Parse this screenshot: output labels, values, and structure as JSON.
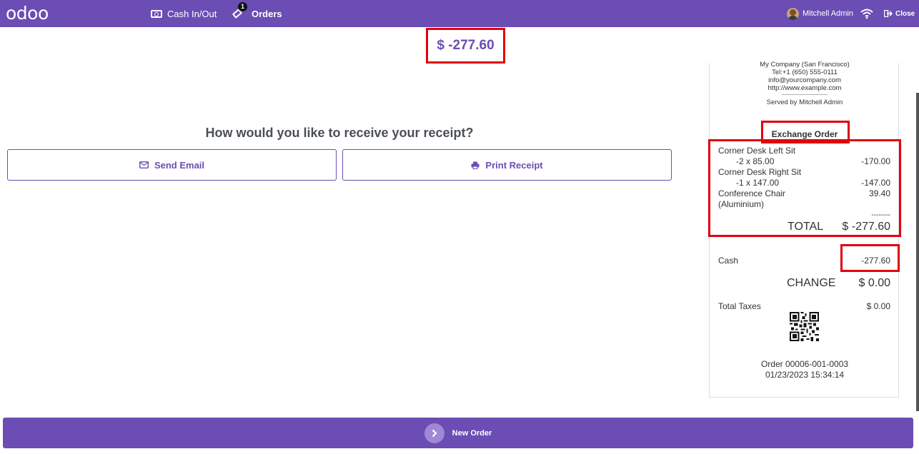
{
  "header": {
    "logo": "odoo",
    "cash_label": "Cash In/Out",
    "orders_label": "Orders",
    "orders_badge": "1",
    "user_name": "Mitchell Admin",
    "close_label": "Close"
  },
  "main": {
    "amount": "$ -277.60",
    "question": "How would you like to receive your receipt?",
    "send_email_label": "Send Email",
    "print_receipt_label": "Print Receipt"
  },
  "receipt": {
    "company_lines": [
      "My Company (San Francisco)",
      "Tel:+1 (650) 555-0111",
      "info@yourcompany.com",
      "http://www.example.com",
      "--------------------------------",
      "Served by Mitchell Admin"
    ],
    "title": "Exchange Order",
    "lines": [
      {
        "name": "Corner Desk Left Sit",
        "detail": "-2 x 85.00",
        "amount": "-170.00"
      },
      {
        "name": "Corner Desk Right Sit",
        "detail": "-1 x 147.00",
        "amount": "-147.00"
      },
      {
        "name": "Conference Chair",
        "name2": "(Aluminium)",
        "amount": "39.40"
      }
    ],
    "separator": "--------",
    "total_label": "TOTAL",
    "total_value": "$ -277.60",
    "payment_method": "Cash",
    "payment_amount": "-277.60",
    "change_label": "CHANGE",
    "change_value": "$ 0.00",
    "taxes_label": "Total Taxes",
    "taxes_value": "$ 0.00",
    "order_ref": "Order 00006-001-0003",
    "order_date": "01/23/2023 15:34:14"
  },
  "footer": {
    "new_order_label": "New Order"
  },
  "colors": {
    "brand": "#6b4db4",
    "highlight": "#e0000f"
  }
}
